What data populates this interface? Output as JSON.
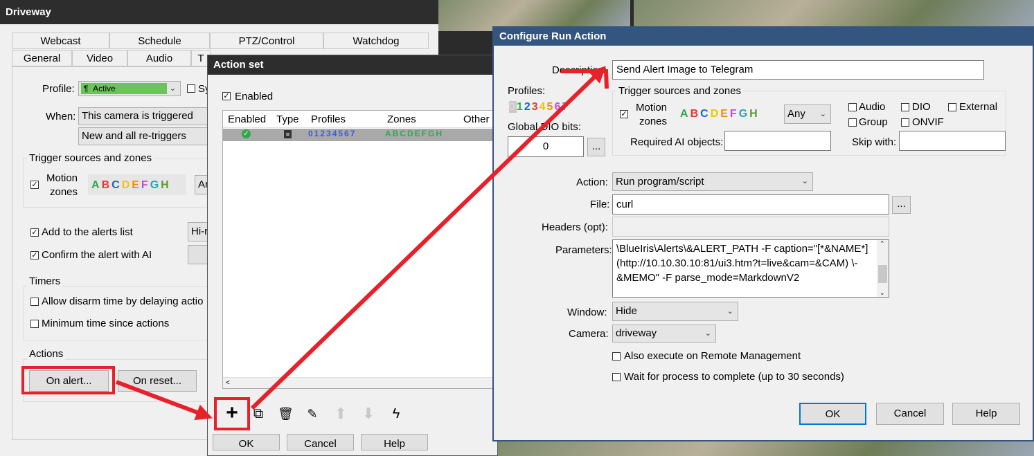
{
  "colors": {
    "title_dark": "#2d2d2d",
    "title_blue": "#34557f",
    "arrow_red": "#e8202a",
    "active_green": "#6ec25b",
    "ok_border": "#0078d7"
  },
  "driveway": {
    "title": "Driveway",
    "tabs_row1": [
      "Webcast",
      "Schedule",
      "PTZ/Control",
      "Watchdog"
    ],
    "tabs_row2": [
      "General",
      "Video",
      "Audio",
      "T"
    ],
    "profile_label": "Profile:",
    "profile_value": "Active",
    "sync_label": "Sy",
    "when_label": "When:",
    "when_value1": "This camera is triggered",
    "when_value2": "New and all re-triggers",
    "trigger_group": "Trigger sources and zones",
    "motion_label1": "Motion",
    "motion_label2": "zones",
    "zones": [
      "A",
      "B",
      "C",
      "D",
      "E",
      "F",
      "G",
      "H"
    ],
    "any_short": "An",
    "add_alerts": "Add to the alerts list",
    "hi_short": "Hi-r",
    "confirm_ai": "Confirm the alert with AI",
    "timers_group": "Timers",
    "allow_disarm": "Allow disarm time by delaying actio",
    "min_time": "Minimum time since actions",
    "actions_group": "Actions",
    "on_alert": "On alert...",
    "on_reset": "On reset..."
  },
  "action_set": {
    "title": "Action set",
    "enabled_label": "Enabled",
    "columns": [
      "Enabled",
      "Type",
      "Profiles",
      "Zones",
      "Other s"
    ],
    "row_profiles": "01234567",
    "row_zones": "ABCDEFGH",
    "footer_buttons": [
      "OK",
      "Cancel",
      "Help"
    ],
    "toolbar_icons": [
      "add-icon",
      "copy-add-icon",
      "trash-icon",
      "edit-icon",
      "arrow-up-icon",
      "arrow-down-icon",
      "lightning-icon"
    ]
  },
  "run_action": {
    "title": "Configure Run Action",
    "description_label": "Description:",
    "description_value": "Send Alert Image to Telegram",
    "profiles_label": "Profiles:",
    "profiles_digits": [
      "0",
      "1",
      "2",
      "3",
      "4",
      "5",
      "6",
      "7"
    ],
    "global_dio_label": "Global DIO bits:",
    "global_dio_value": "0",
    "browse": "...",
    "trigger_group": "Trigger sources and zones",
    "motion_label1": "Motion",
    "motion_label2": "zones",
    "zones": [
      "A",
      "B",
      "C",
      "D",
      "E",
      "F",
      "G",
      "H"
    ],
    "any_value": "Any",
    "audio": "Audio",
    "dio": "DIO",
    "external": "External",
    "group": "Group",
    "onvif": "ONVIF",
    "required_ai": "Required AI objects:",
    "skip_with": "Skip with:",
    "action_label": "Action:",
    "action_value": "Run program/script",
    "file_label": "File:",
    "file_value": "curl",
    "headers_label": "Headers (opt):",
    "parameters_label": "Parameters:",
    "param_line1": "\\BlueIris\\Alerts\\&ALERT_PATH -F caption=\"[*&NAME*]",
    "param_line2": "(http://10.10.30.10:81/ui3.htm?t=live&cam=&CAM) \\-",
    "param_line3": "&MEMO\" -F parse_mode=MarkdownV2",
    "window_label": "Window:",
    "window_value": "Hide",
    "camera_label": "Camera:",
    "camera_value": "driveway",
    "remote_mgmt": "Also execute on Remote Management",
    "wait_process": "Wait for process to complete (up to 30 seconds)",
    "ok": "OK",
    "cancel": "Cancel",
    "help": "Help"
  }
}
